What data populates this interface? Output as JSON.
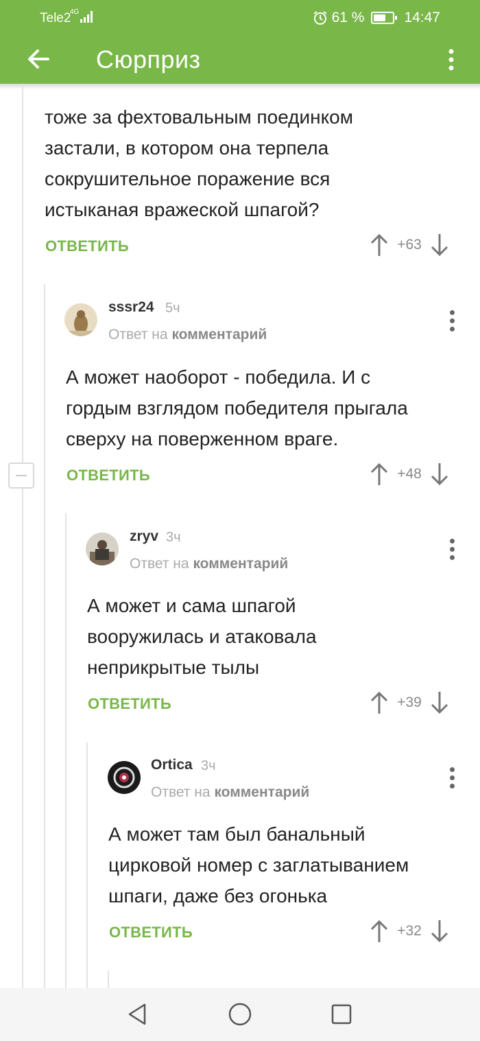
{
  "status_bar": {
    "carrier": "Tele2",
    "network": "4G",
    "battery_percent": "61 %",
    "battery_level": 0.61,
    "time": "14:47"
  },
  "app_bar": {
    "title": "Сюрприз",
    "back_icon": "arrow-left-icon",
    "menu_icon": "more-vertical-icon"
  },
  "colors": {
    "accent": "#79b748",
    "text": "#222222",
    "muted": "#aaaaaa"
  },
  "comments": [
    {
      "text_lines": [
        "тоже за фехтовальным поединком",
        "застали, в котором она терпела",
        "сокрушительное поражение вся",
        "истыканая вражеской шпагой?"
      ],
      "reply_label": "ОТВЕТИТЬ",
      "score": "+63"
    },
    {
      "username": "sssr24",
      "time": "5ч",
      "reply_to_prefix": "Ответ на",
      "reply_to_link": "комментарий",
      "text_lines": [
        "А может наоборот - победила.  И с",
        "гордым взглядом победителя прыгала",
        "сверху на поверженном враге."
      ],
      "reply_label": "ОТВЕТИТЬ",
      "score": "+48"
    },
    {
      "username": "zryv",
      "time": "3ч",
      "reply_to_prefix": "Ответ на",
      "reply_to_link": "комментарий",
      "text_lines": [
        "А может и сама шпагой",
        "вооружилась и атаковала",
        "неприкрытые тылы"
      ],
      "reply_label": "ОТВЕТИТЬ",
      "score": "+39"
    },
    {
      "username": "Ortica",
      "time": "3ч",
      "reply_to_prefix": "Ответ на",
      "reply_to_link": "комментарий",
      "text_lines": [
        "А может там был банальный",
        "цирковой номер с заглатыванием",
        "шпаги, даже без огонька"
      ],
      "reply_label": "ОТВЕТИТЬ",
      "score": "+32"
    }
  ],
  "nav_bar": {
    "back": "triangle-back-icon",
    "home": "circle-home-icon",
    "recents": "square-recents-icon"
  }
}
